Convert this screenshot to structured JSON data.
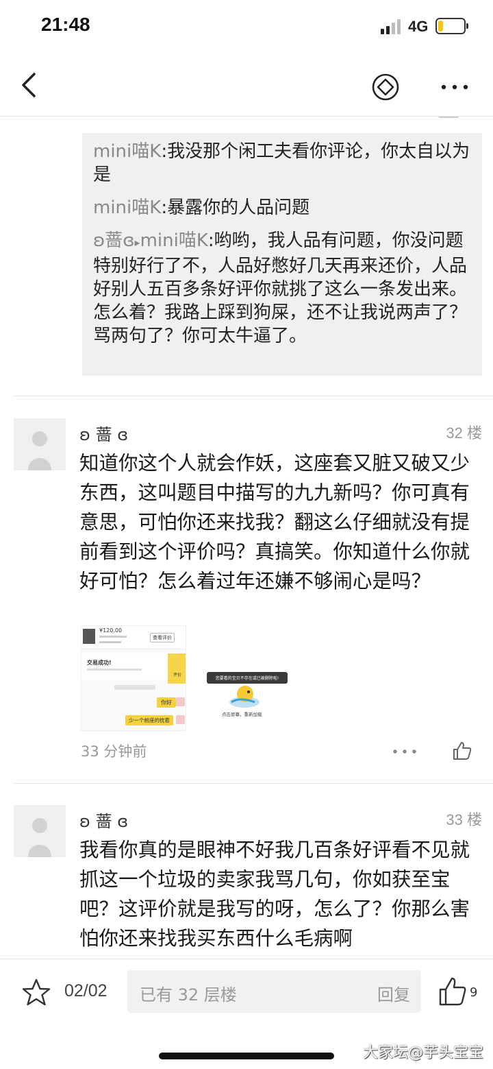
{
  "status_bar": {
    "time": "21:48",
    "network": "4G",
    "battery_level": 0.2,
    "battery_color": "#f5c518"
  },
  "nav": {
    "back_icon": "chevron-left-icon",
    "compass_icon": "compass-icon",
    "more_icon": "more-dots-icon"
  },
  "quote": {
    "lines": [
      {
        "name": "mini喵K",
        "text": ":我没那个闲工夫看你评论，你太自以为是"
      },
      {
        "name": "mini喵K",
        "text": ":暴露你的人品问题"
      },
      {
        "name": "ʚ蔷ɞ",
        "arrow": "▸",
        "name2": "mini喵K",
        "text": ":哟哟，我人品有问题，你没问题特别好行了不，人品好憋好几天再来还价，人品好别人五百多条好评你就挑了这么一条发出来。怎么着？我路上踩到狗屎，还不让我说两声了？骂两句了？你可太牛逼了。"
      }
    ]
  },
  "posts": [
    {
      "user": "ʚ 蔷 ɞ",
      "floor": "32 楼",
      "body": "知道你这个人就会作妖，这座套又脏又破又少东西，这叫题目中描写的九九新吗？你可真有意思，可怕你还来找我？翻这么仔细就没有提前看到这个评价吗？真搞笑。你知道什么你就好可怕？怎么着过年还嫌不够闹心是吗？",
      "time": "33 分钟前",
      "thumb1": {
        "price": "¥120.00",
        "button": "查看评价",
        "status": "交易成功!",
        "bubble1": "你好",
        "bubble2": "少一个前座的枕套",
        "comment_icon_label": "评价"
      },
      "thumb2": {
        "error": "您要看的宝贝不存在或已被删除啦!",
        "retry": "点击屏幕，重新加载"
      }
    },
    {
      "user": "ʚ 蔷 ɞ",
      "floor": "33 楼",
      "body": "我看你真的是眼神不好我几百条好评看不见就抓这一个垃圾的卖家我骂几句，你如获至宝吧？这评价就是我写的呀，怎么了？你那么害怕你还来找我买东西什么毛病啊"
    }
  ],
  "bottom_bar": {
    "page": "02/02",
    "reply_placeholder": "已有 32 层楼",
    "reply_action": "回复",
    "like_count": "9",
    "watermark": "大家坛@芋头宝宝"
  }
}
